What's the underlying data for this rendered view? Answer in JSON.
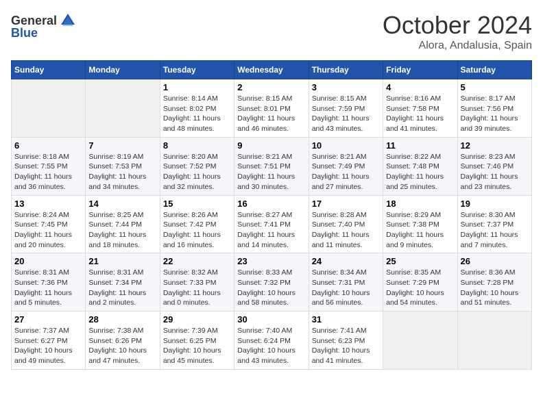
{
  "header": {
    "logo_general": "General",
    "logo_blue": "Blue",
    "month": "October 2024",
    "location": "Alora, Andalusia, Spain"
  },
  "weekdays": [
    "Sunday",
    "Monday",
    "Tuesday",
    "Wednesday",
    "Thursday",
    "Friday",
    "Saturday"
  ],
  "weeks": [
    [
      null,
      null,
      {
        "day": "1",
        "sunrise": "Sunrise: 8:14 AM",
        "sunset": "Sunset: 8:02 PM",
        "daylight": "Daylight: 11 hours and 48 minutes."
      },
      {
        "day": "2",
        "sunrise": "Sunrise: 8:15 AM",
        "sunset": "Sunset: 8:01 PM",
        "daylight": "Daylight: 11 hours and 46 minutes."
      },
      {
        "day": "3",
        "sunrise": "Sunrise: 8:15 AM",
        "sunset": "Sunset: 7:59 PM",
        "daylight": "Daylight: 11 hours and 43 minutes."
      },
      {
        "day": "4",
        "sunrise": "Sunrise: 8:16 AM",
        "sunset": "Sunset: 7:58 PM",
        "daylight": "Daylight: 11 hours and 41 minutes."
      },
      {
        "day": "5",
        "sunrise": "Sunrise: 8:17 AM",
        "sunset": "Sunset: 7:56 PM",
        "daylight": "Daylight: 11 hours and 39 minutes."
      }
    ],
    [
      {
        "day": "6",
        "sunrise": "Sunrise: 8:18 AM",
        "sunset": "Sunset: 7:55 PM",
        "daylight": "Daylight: 11 hours and 36 minutes."
      },
      {
        "day": "7",
        "sunrise": "Sunrise: 8:19 AM",
        "sunset": "Sunset: 7:53 PM",
        "daylight": "Daylight: 11 hours and 34 minutes."
      },
      {
        "day": "8",
        "sunrise": "Sunrise: 8:20 AM",
        "sunset": "Sunset: 7:52 PM",
        "daylight": "Daylight: 11 hours and 32 minutes."
      },
      {
        "day": "9",
        "sunrise": "Sunrise: 8:21 AM",
        "sunset": "Sunset: 7:51 PM",
        "daylight": "Daylight: 11 hours and 30 minutes."
      },
      {
        "day": "10",
        "sunrise": "Sunrise: 8:21 AM",
        "sunset": "Sunset: 7:49 PM",
        "daylight": "Daylight: 11 hours and 27 minutes."
      },
      {
        "day": "11",
        "sunrise": "Sunrise: 8:22 AM",
        "sunset": "Sunset: 7:48 PM",
        "daylight": "Daylight: 11 hours and 25 minutes."
      },
      {
        "day": "12",
        "sunrise": "Sunrise: 8:23 AM",
        "sunset": "Sunset: 7:46 PM",
        "daylight": "Daylight: 11 hours and 23 minutes."
      }
    ],
    [
      {
        "day": "13",
        "sunrise": "Sunrise: 8:24 AM",
        "sunset": "Sunset: 7:45 PM",
        "daylight": "Daylight: 11 hours and 20 minutes."
      },
      {
        "day": "14",
        "sunrise": "Sunrise: 8:25 AM",
        "sunset": "Sunset: 7:44 PM",
        "daylight": "Daylight: 11 hours and 18 minutes."
      },
      {
        "day": "15",
        "sunrise": "Sunrise: 8:26 AM",
        "sunset": "Sunset: 7:42 PM",
        "daylight": "Daylight: 11 hours and 16 minutes."
      },
      {
        "day": "16",
        "sunrise": "Sunrise: 8:27 AM",
        "sunset": "Sunset: 7:41 PM",
        "daylight": "Daylight: 11 hours and 14 minutes."
      },
      {
        "day": "17",
        "sunrise": "Sunrise: 8:28 AM",
        "sunset": "Sunset: 7:40 PM",
        "daylight": "Daylight: 11 hours and 11 minutes."
      },
      {
        "day": "18",
        "sunrise": "Sunrise: 8:29 AM",
        "sunset": "Sunset: 7:38 PM",
        "daylight": "Daylight: 11 hours and 9 minutes."
      },
      {
        "day": "19",
        "sunrise": "Sunrise: 8:30 AM",
        "sunset": "Sunset: 7:37 PM",
        "daylight": "Daylight: 11 hours and 7 minutes."
      }
    ],
    [
      {
        "day": "20",
        "sunrise": "Sunrise: 8:31 AM",
        "sunset": "Sunset: 7:36 PM",
        "daylight": "Daylight: 11 hours and 5 minutes."
      },
      {
        "day": "21",
        "sunrise": "Sunrise: 8:31 AM",
        "sunset": "Sunset: 7:34 PM",
        "daylight": "Daylight: 11 hours and 2 minutes."
      },
      {
        "day": "22",
        "sunrise": "Sunrise: 8:32 AM",
        "sunset": "Sunset: 7:33 PM",
        "daylight": "Daylight: 11 hours and 0 minutes."
      },
      {
        "day": "23",
        "sunrise": "Sunrise: 8:33 AM",
        "sunset": "Sunset: 7:32 PM",
        "daylight": "Daylight: 10 hours and 58 minutes."
      },
      {
        "day": "24",
        "sunrise": "Sunrise: 8:34 AM",
        "sunset": "Sunset: 7:31 PM",
        "daylight": "Daylight: 10 hours and 56 minutes."
      },
      {
        "day": "25",
        "sunrise": "Sunrise: 8:35 AM",
        "sunset": "Sunset: 7:29 PM",
        "daylight": "Daylight: 10 hours and 54 minutes."
      },
      {
        "day": "26",
        "sunrise": "Sunrise: 8:36 AM",
        "sunset": "Sunset: 7:28 PM",
        "daylight": "Daylight: 10 hours and 51 minutes."
      }
    ],
    [
      {
        "day": "27",
        "sunrise": "Sunrise: 7:37 AM",
        "sunset": "Sunset: 6:27 PM",
        "daylight": "Daylight: 10 hours and 49 minutes."
      },
      {
        "day": "28",
        "sunrise": "Sunrise: 7:38 AM",
        "sunset": "Sunset: 6:26 PM",
        "daylight": "Daylight: 10 hours and 47 minutes."
      },
      {
        "day": "29",
        "sunrise": "Sunrise: 7:39 AM",
        "sunset": "Sunset: 6:25 PM",
        "daylight": "Daylight: 10 hours and 45 minutes."
      },
      {
        "day": "30",
        "sunrise": "Sunrise: 7:40 AM",
        "sunset": "Sunset: 6:24 PM",
        "daylight": "Daylight: 10 hours and 43 minutes."
      },
      {
        "day": "31",
        "sunrise": "Sunrise: 7:41 AM",
        "sunset": "Sunset: 6:23 PM",
        "daylight": "Daylight: 10 hours and 41 minutes."
      },
      null,
      null
    ]
  ]
}
